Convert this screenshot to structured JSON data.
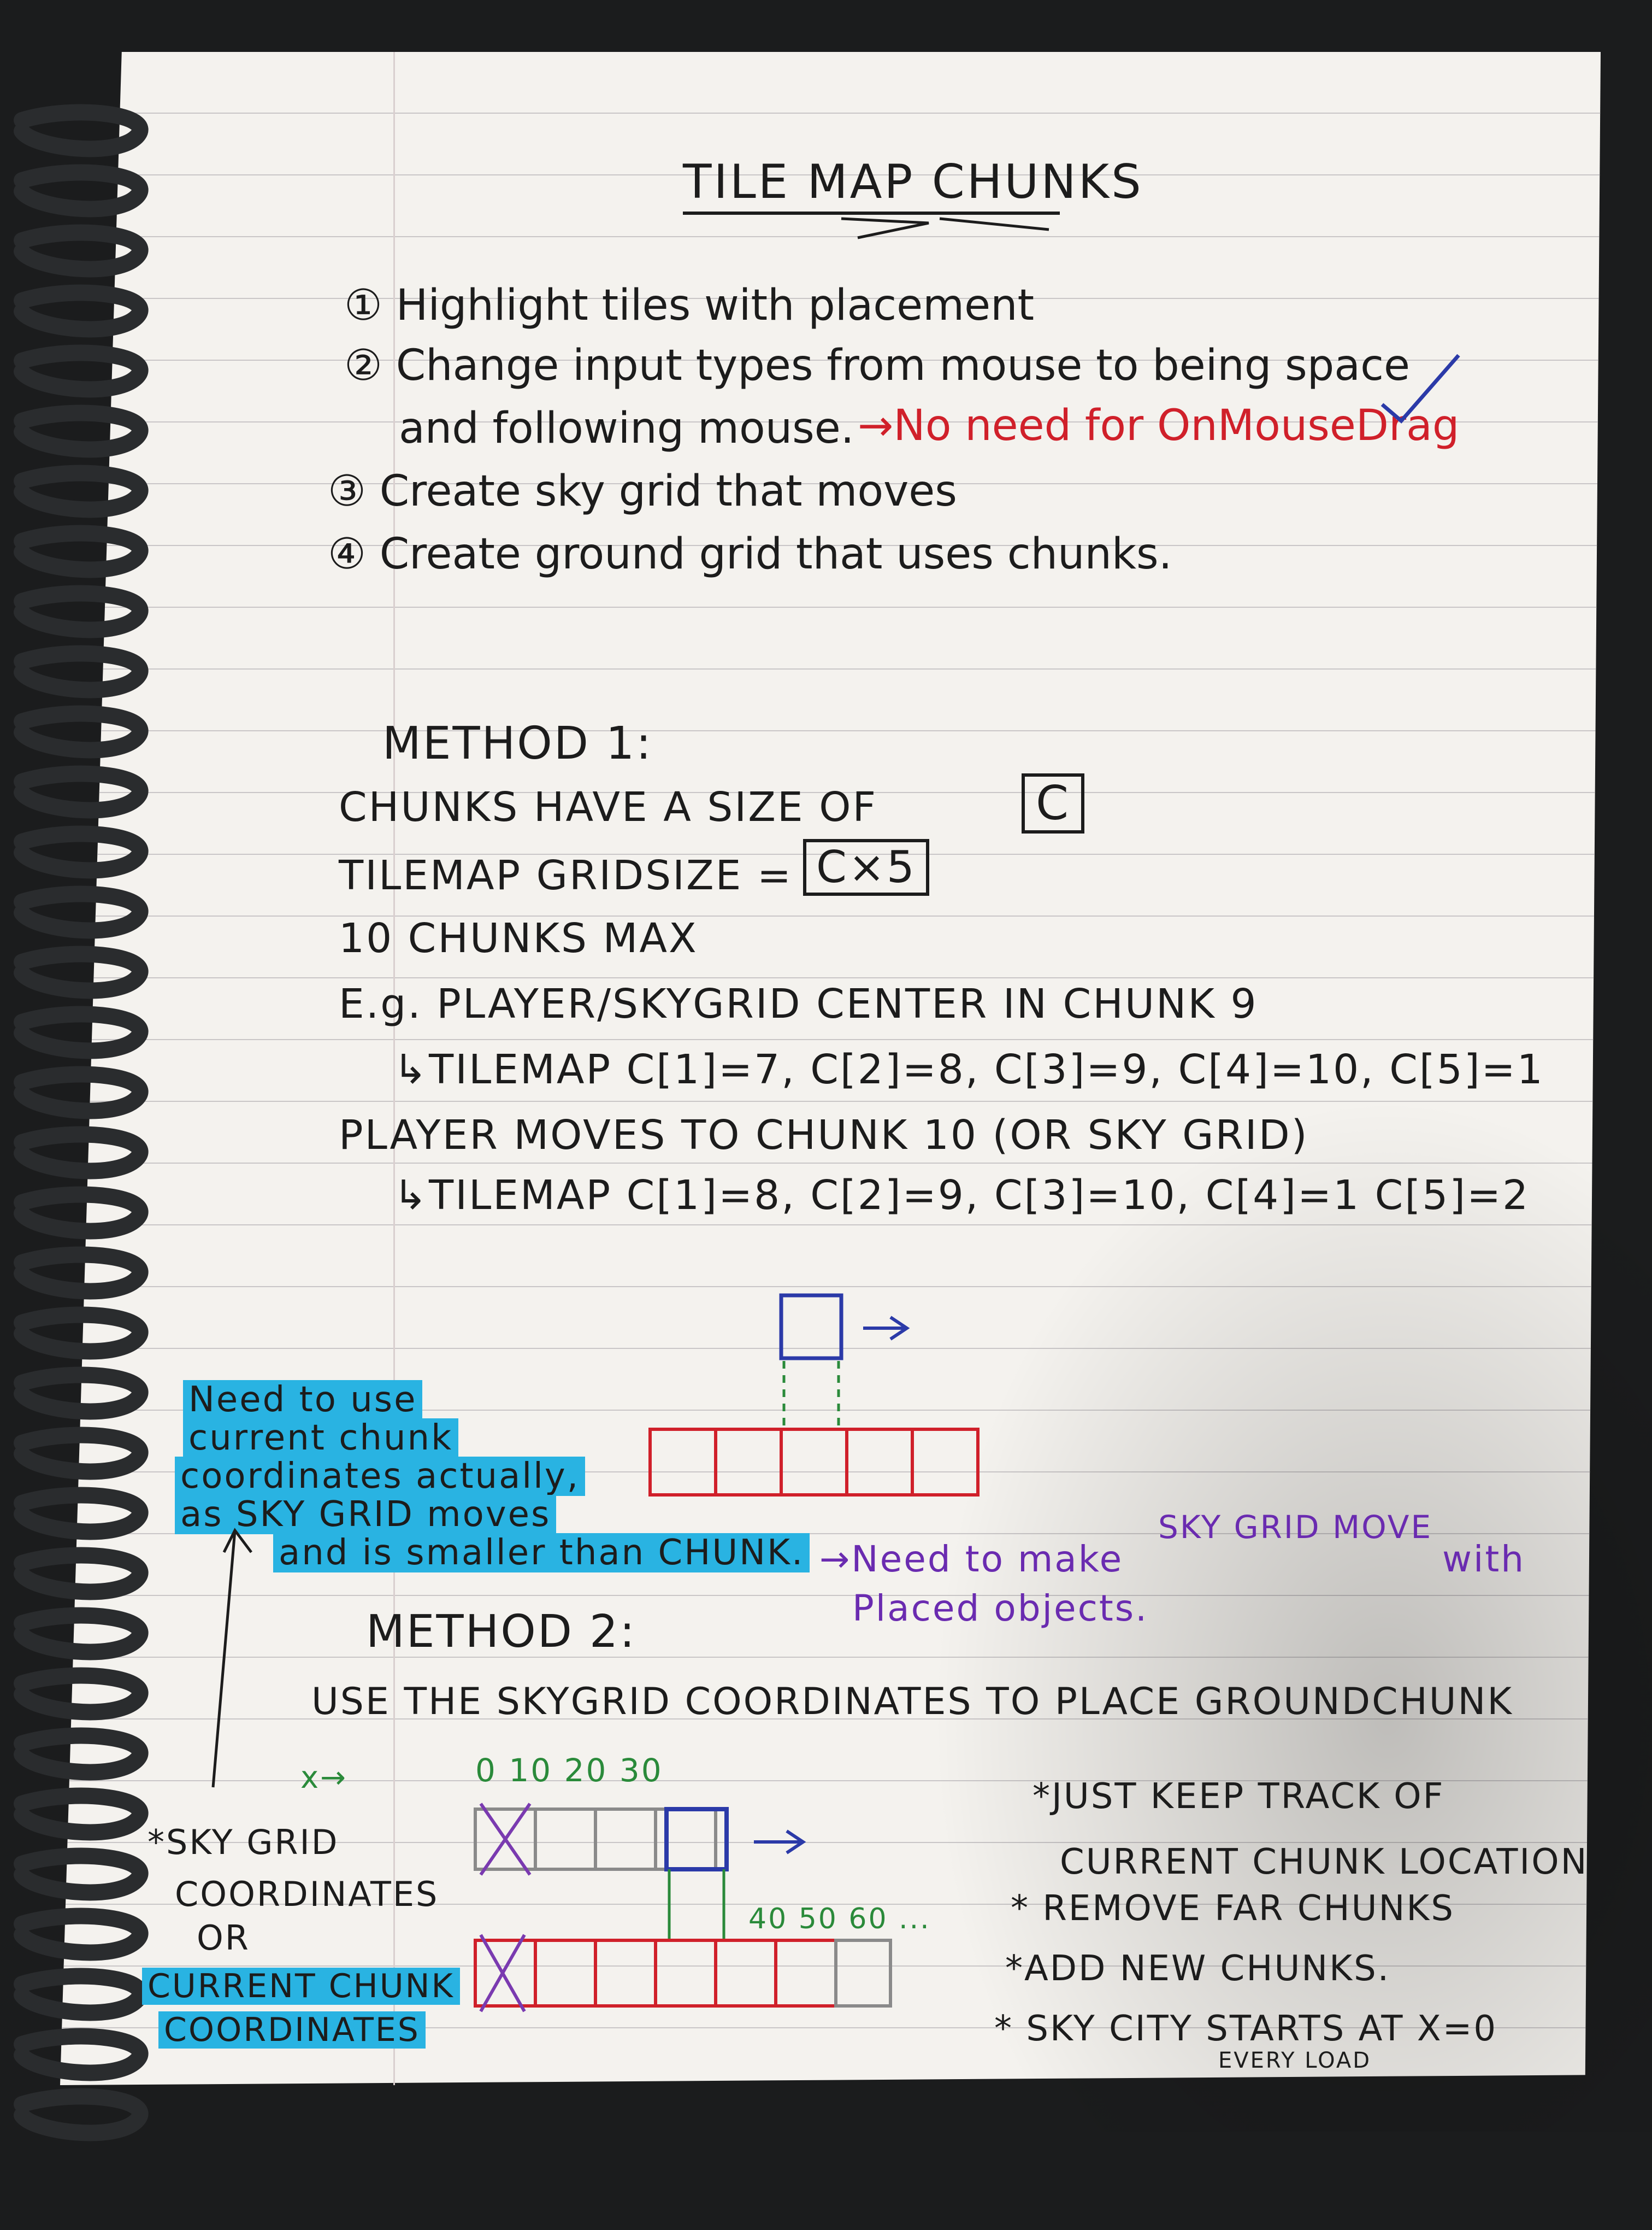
{
  "title": "TILE MAP CHUNKS",
  "todo": [
    "① Highlight tiles with placement",
    "② Change input types from mouse to being space",
    "and following mouse.",
    "→No need for OnMouseDrag",
    "③ Create sky grid that moves",
    "④ Create ground grid that uses chunks."
  ],
  "method1": {
    "heading": "METHOD 1:",
    "lines": [
      "CHUNKS HAVE A SIZE OF",
      "C",
      "TILEMAP GRIDSIZE =",
      "C×5",
      "10 CHUNKS MAX",
      "E.g. PLAYER/SKYGRID CENTER IN CHUNK 9",
      "↳TILEMAP C[1]=7, C[2]=8, C[3]=9, C[4]=10, C[5]=1",
      "PLAYER MOVES TO CHUNK 10 (OR SKY GRID)",
      "↳TILEMAP C[1]=8, C[2]=9, C[3]=10, C[4]=1 C[5]=2"
    ]
  },
  "notes": {
    "blue_note": [
      "Need to use",
      "current chunk",
      "coordinates actually,",
      "as SKY GRID moves",
      "and is smaller than CHUNK."
    ],
    "purple_note": [
      "→Need to make",
      "SKY GRID MOVE",
      "with",
      "Placed objects."
    ]
  },
  "method2": {
    "heading": "METHOD 2:",
    "line": "USE THE SKYGRID COORDINATES TO PLACE GROUNDCHUNK",
    "x_label": "x→",
    "top_numbers": "0 10 20 30",
    "bottom_numbers": "40 50 60 ...",
    "left_labels": [
      "*SKY GRID",
      "COORDINATES",
      "OR",
      "CURRENT CHUNK",
      "COORDINATES"
    ],
    "bullets": [
      "*JUST KEEP TRACK OF",
      "CURRENT CHUNK LOCATION",
      "* REMOVE FAR CHUNKS",
      "*ADD NEW CHUNKS.",
      "* SKY CITY STARTS AT X=0",
      "EVERY LOAD"
    ]
  }
}
